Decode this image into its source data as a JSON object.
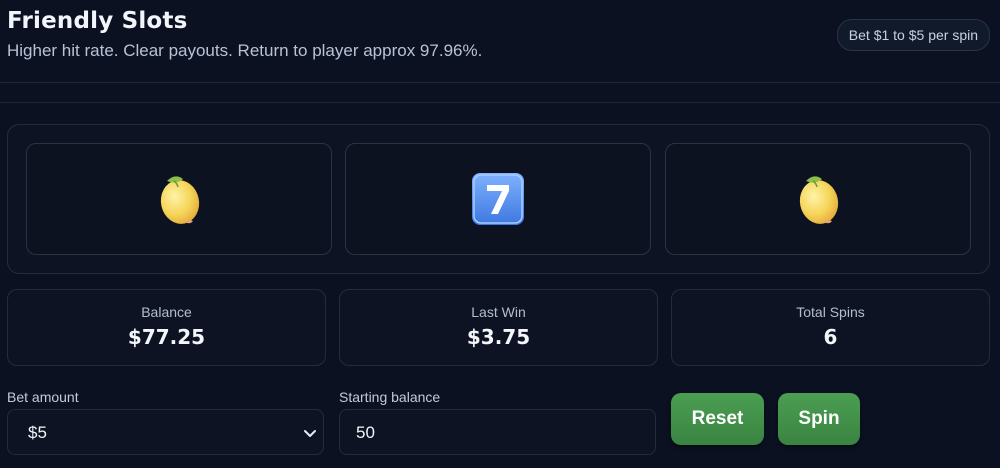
{
  "header": {
    "title": "Friendly Slots",
    "subtitle": "Higher hit rate. Clear payouts. Return to player approx 97.96%.",
    "bet_badge": "Bet $1 to $5 per spin"
  },
  "reels": [
    {
      "symbol": "lemon-icon"
    },
    {
      "symbol": "seven-icon"
    },
    {
      "symbol": "lemon-icon"
    }
  ],
  "stats": {
    "balance_label": "Balance",
    "balance_value": "$77.25",
    "last_win_label": "Last Win",
    "last_win_value": "$3.75",
    "total_spins_label": "Total Spins",
    "total_spins_value": "6"
  },
  "controls": {
    "bet_label": "Bet amount",
    "bet_value": "$5",
    "starting_label": "Starting balance",
    "starting_value": "50",
    "reset_label": "Reset",
    "spin_label": "Spin"
  },
  "colors": {
    "background": "#0b1120",
    "panel": "#0d1322",
    "button": "#3f8f47",
    "text": "#f2f5fb"
  }
}
